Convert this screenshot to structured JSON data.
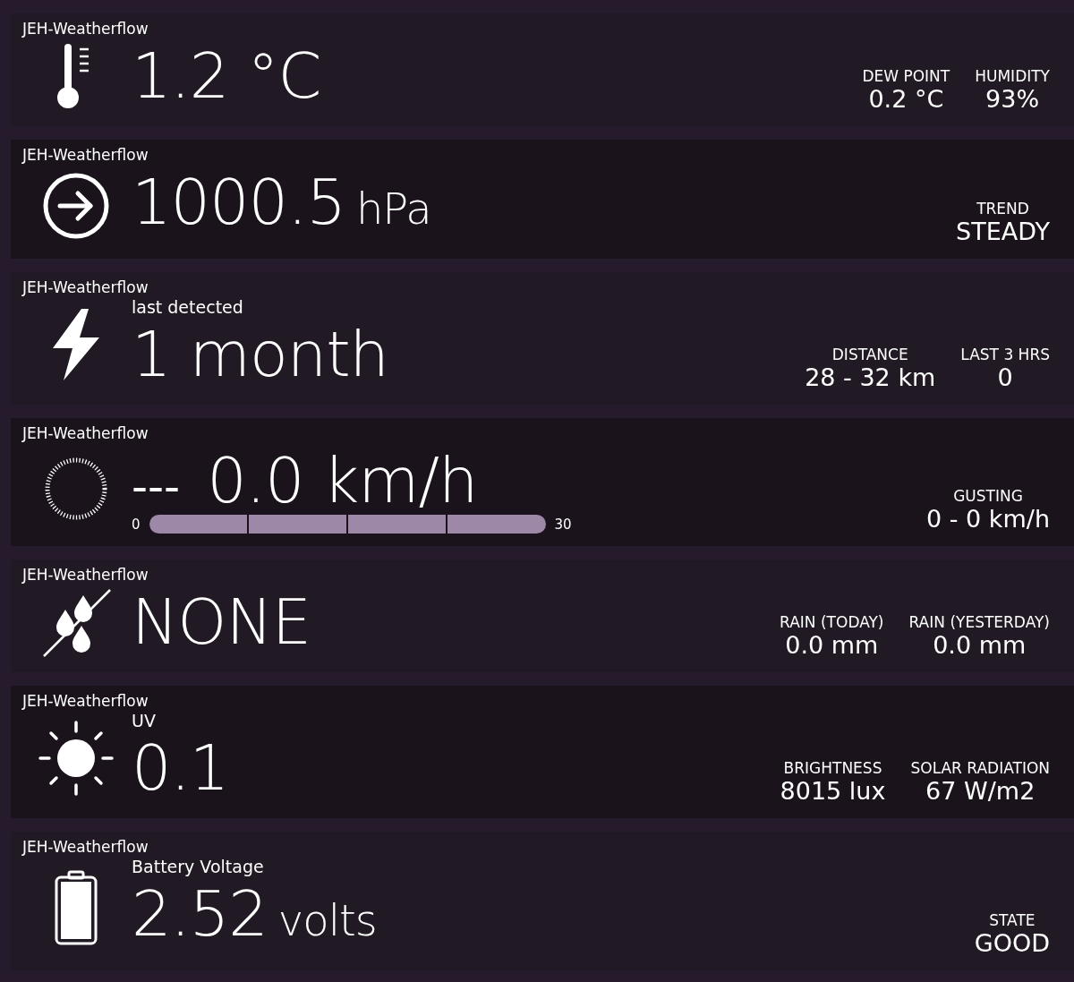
{
  "cards": [
    {
      "kind": "temperature",
      "device": "JEH-Weatherflow",
      "value": "1.2 °C",
      "stats": [
        {
          "label": "DEW POINT",
          "value": "0.2 °C"
        },
        {
          "label": "HUMIDITY",
          "value": "93%"
        }
      ]
    },
    {
      "kind": "pressure",
      "device": "JEH-Weatherflow",
      "value": "1000.5",
      "unit": "hPa",
      "stats": [
        {
          "label": "TREND",
          "value": "STEADY"
        }
      ]
    },
    {
      "kind": "lightning",
      "device": "JEH-Weatherflow",
      "caption": "last detected",
      "value": "1 month",
      "stats": [
        {
          "label": "DISTANCE",
          "value": "28 - 32 km"
        },
        {
          "label": "LAST 3 HRS",
          "value": "0"
        }
      ]
    },
    {
      "kind": "wind",
      "device": "JEH-Weatherflow",
      "direction": "---",
      "value": "0.0 km/h",
      "scale": {
        "min": "0",
        "max": "30"
      },
      "stats": [
        {
          "label": "GUSTING",
          "value": "0 - 0 km/h"
        }
      ]
    },
    {
      "kind": "rain",
      "device": "JEH-Weatherflow",
      "value": "NONE",
      "stats": [
        {
          "label": "RAIN (TODAY)",
          "value": "0.0 mm"
        },
        {
          "label": "RAIN (YESTERDAY)",
          "value": "0.0 mm"
        }
      ]
    },
    {
      "kind": "uv",
      "device": "JEH-Weatherflow",
      "caption": "UV",
      "value": "0.1",
      "stats": [
        {
          "label": "BRIGHTNESS",
          "value": "8015 lux"
        },
        {
          "label": "SOLAR RADIATION",
          "value": "67 W/m2"
        }
      ]
    },
    {
      "kind": "battery",
      "device": "JEH-Weatherflow",
      "caption": "Battery Voltage",
      "value": "2.52",
      "unit": "volts",
      "stats": [
        {
          "label": "STATE",
          "value": "GOOD"
        }
      ]
    }
  ]
}
